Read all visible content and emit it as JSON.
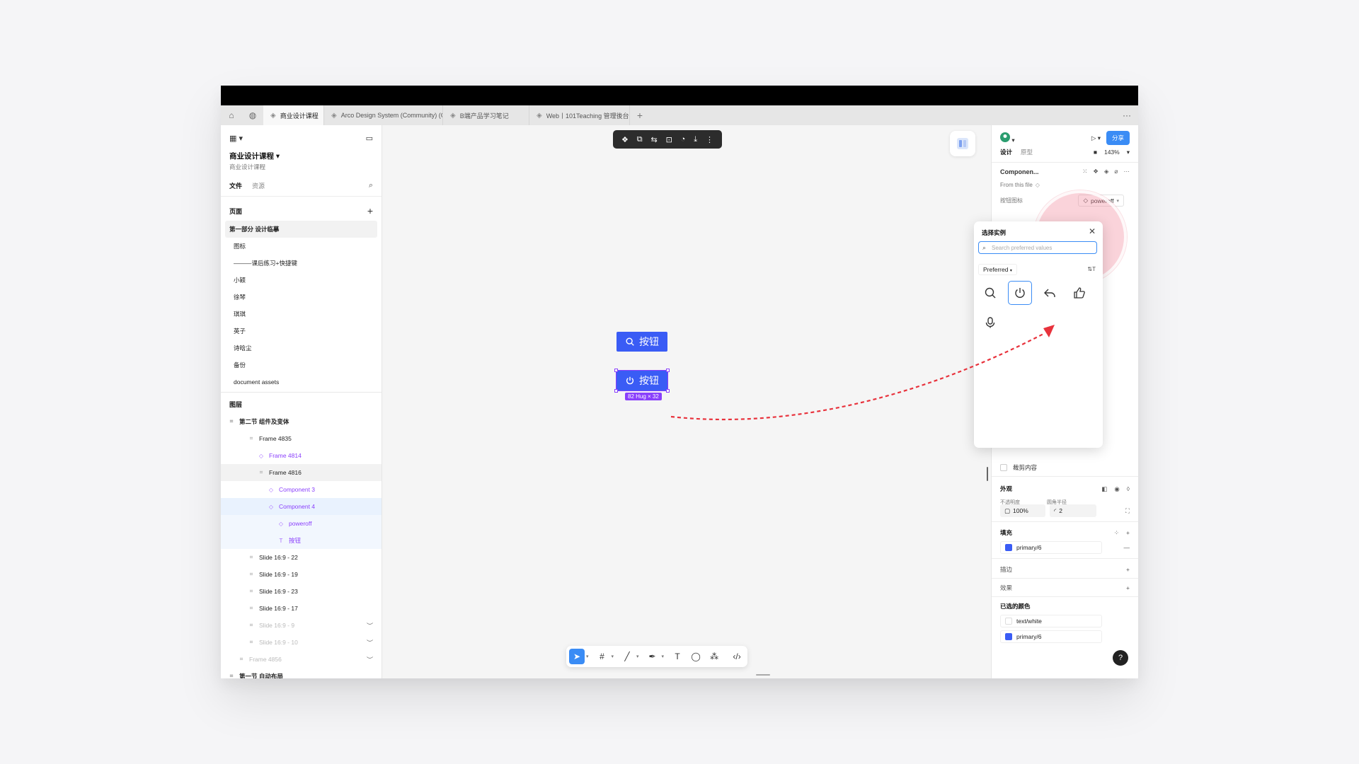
{
  "tabs": [
    {
      "label": "商业设计课程",
      "active": true
    },
    {
      "label": "Arco Design System (Community) (C",
      "active": false
    },
    {
      "label": "B端产品学习笔记",
      "active": false
    },
    {
      "label": "Web丨101Teaching 管理後台",
      "active": false
    }
  ],
  "left": {
    "project_title": "商业设计课程",
    "project_sub": "商业设计课程",
    "tab_files": "文件",
    "tab_assets": "资源",
    "pages_header": "页面",
    "pages": [
      "第一部分 设计临摹",
      "图标",
      "———课后练习+快捷键",
      "小颖",
      "徐琴",
      "琪琪",
      "英子",
      "诗晗尘",
      "备份",
      "document assets"
    ],
    "layers_header": "图层",
    "layers": [
      {
        "label": "第二节 组件及变体",
        "indent": 0,
        "bold": true
      },
      {
        "label": "Frame 4835",
        "indent": 2
      },
      {
        "label": "Frame 4814",
        "indent": 3,
        "purple": true
      },
      {
        "label": "Frame 4816",
        "indent": 3
      },
      {
        "label": "Component 3",
        "indent": 4,
        "purple": true
      },
      {
        "label": "Component 4",
        "indent": 4,
        "purple": true
      },
      {
        "label": "poweroff",
        "indent": 5,
        "purple": true
      },
      {
        "label": "按钮",
        "indent": 5,
        "purple": true
      },
      {
        "label": "Slide 16:9 - 22",
        "indent": 2
      },
      {
        "label": "Slide 16:9 - 19",
        "indent": 2
      },
      {
        "label": "Slide 16:9 - 23",
        "indent": 2
      },
      {
        "label": "Slide 16:9 - 17",
        "indent": 2
      },
      {
        "label": "Slide 16:9 - 9",
        "indent": 2,
        "gray": true
      },
      {
        "label": "Slide 16:9 - 10",
        "indent": 2,
        "gray": true
      },
      {
        "label": "Frame 4856",
        "indent": 1,
        "gray": true
      },
      {
        "label": "第一节 自动布局",
        "indent": 0,
        "bold": true
      }
    ]
  },
  "canvas": {
    "button1_label": "按钮",
    "button2_label": "按钮",
    "size_badge": "82 Hug × 32"
  },
  "right": {
    "tab_design": "设计",
    "tab_prototype": "原型",
    "zoom": "143%",
    "share": "分享",
    "component_name": "Componen...",
    "from_file": "From this file",
    "prop_label": "按钮图标",
    "prop_value": "poweroff",
    "clip_label": "裁剪内容",
    "appearance": "外观",
    "opacity_label": "不透明度",
    "radius_label": "圆角半径",
    "opacity": "100%",
    "radius": "2",
    "fill_header": "填充",
    "fill_value": "primary/6",
    "stroke_header": "描边",
    "effects_header": "效果",
    "selected_colors": "已选的颜色",
    "color1": "text/white",
    "color2": "primary/6",
    "help": "?"
  },
  "popover": {
    "title": "选择实例",
    "search_placeholder": "Search preferred values",
    "preferred": "Preferred"
  },
  "colors": {
    "primary": "#3a5cf5",
    "accent": "#3a8cf5",
    "purple": "#8a3ffc",
    "annotation": "#e8323c"
  },
  "icons": [
    "search-icon",
    "poweroff-icon",
    "undo-icon",
    "thumb-up-icon",
    "microphone-icon"
  ]
}
